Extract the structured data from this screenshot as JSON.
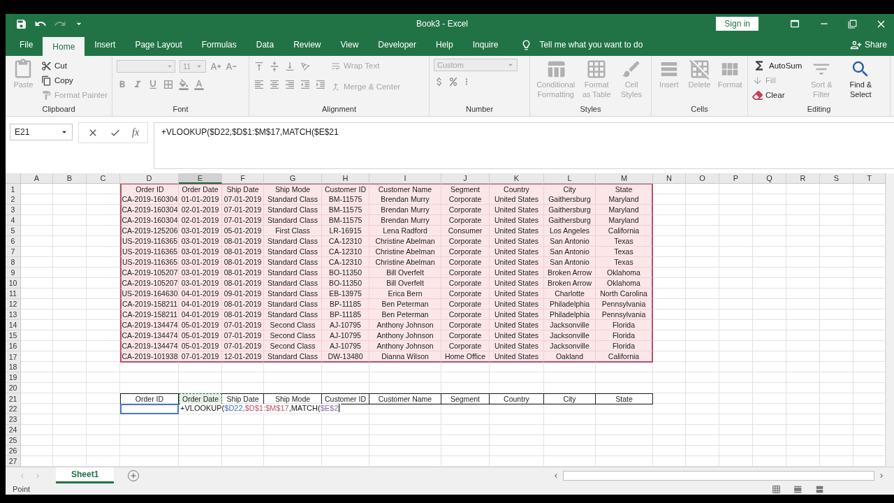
{
  "window": {
    "title": "Book3  -  Excel",
    "sign_in": "Sign in"
  },
  "tabs": [
    {
      "label": "File",
      "selected": false
    },
    {
      "label": "Home",
      "selected": true
    },
    {
      "label": "Insert",
      "selected": false
    },
    {
      "label": "Page Layout",
      "selected": false
    },
    {
      "label": "Formulas",
      "selected": false
    },
    {
      "label": "Data",
      "selected": false
    },
    {
      "label": "Review",
      "selected": false
    },
    {
      "label": "View",
      "selected": false
    },
    {
      "label": "Developer",
      "selected": false
    },
    {
      "label": "Help",
      "selected": false
    },
    {
      "label": "Inquire",
      "selected": false
    }
  ],
  "tell_me": "Tell me what you want to do",
  "share": "Share",
  "ribbon": [
    {
      "kind": "clipboard",
      "name": "Clipboard",
      "commands": [
        {
          "kind": "large",
          "label": "Paste",
          "disabled": true
        },
        {
          "kind": "small",
          "label": "Cut",
          "disabled": false
        },
        {
          "kind": "small",
          "label": "Copy",
          "disabled": false
        },
        {
          "kind": "small",
          "label": "Format Painter",
          "disabled": true
        }
      ]
    },
    {
      "kind": "font",
      "name": "Font",
      "commands": [
        {
          "kind": "combo",
          "label": "11",
          "disabled": true
        }
      ]
    },
    {
      "kind": "alignment",
      "name": "Alignment",
      "commands": [
        {
          "kind": "small",
          "label": "Wrap Text",
          "disabled": true
        },
        {
          "kind": "small",
          "label": "Merge & Center",
          "disabled": true
        }
      ]
    },
    {
      "kind": "number",
      "name": "Number",
      "commands": [
        {
          "kind": "combo",
          "label": "Custom",
          "disabled": true
        }
      ]
    },
    {
      "kind": "styles",
      "name": "Styles",
      "commands": [
        {
          "kind": "large",
          "label": "Conditional Formatting",
          "disabled": true
        },
        {
          "kind": "large",
          "label": "Format as Table",
          "disabled": true
        },
        {
          "kind": "large",
          "label": "Cell Styles",
          "disabled": true
        }
      ]
    },
    {
      "kind": "cells",
      "name": "Cells",
      "commands": [
        {
          "kind": "large",
          "label": "Insert",
          "disabled": true
        },
        {
          "kind": "large",
          "label": "Delete",
          "disabled": true
        },
        {
          "kind": "large",
          "label": "Format",
          "disabled": true
        }
      ]
    },
    {
      "kind": "editing",
      "name": "Editing",
      "commands": [
        {
          "kind": "small",
          "label": "AutoSum",
          "disabled": false
        },
        {
          "kind": "small",
          "label": "Fill",
          "disabled": true
        },
        {
          "kind": "small",
          "label": "Clear",
          "disabled": false
        },
        {
          "kind": "large",
          "label": "Sort & Filter",
          "disabled": true
        },
        {
          "kind": "large",
          "label": "Find & Select",
          "disabled": false
        }
      ]
    }
  ],
  "formula_bar": {
    "name_box": "E21",
    "function_button": "fx",
    "formula": "+VLOOKUP($D22,$D$1:$M$17,MATCH($E$21"
  },
  "columns": [
    {
      "label": "A",
      "selected": false
    },
    {
      "label": "B",
      "selected": false
    },
    {
      "label": "C",
      "selected": false
    },
    {
      "label": "D",
      "selected": false
    },
    {
      "label": "E",
      "selected": true
    },
    {
      "label": "F",
      "selected": false
    },
    {
      "label": "G",
      "selected": false
    },
    {
      "label": "H",
      "selected": false
    },
    {
      "label": "I",
      "selected": false
    },
    {
      "label": "J",
      "selected": false
    },
    {
      "label": "K",
      "selected": false
    },
    {
      "label": "L",
      "selected": false
    },
    {
      "label": "M",
      "selected": false
    },
    {
      "label": "N",
      "selected": false
    },
    {
      "label": "O",
      "selected": false
    },
    {
      "label": "P",
      "selected": false
    },
    {
      "label": "Q",
      "selected": false
    },
    {
      "label": "R",
      "selected": false
    },
    {
      "label": "S",
      "selected": false
    },
    {
      "label": "T",
      "selected": false
    }
  ],
  "rows": [
    {
      "number": "1",
      "kind": "source",
      "cells": [
        "Order ID",
        "Order Date",
        "Ship Date",
        "Ship Mode",
        "Customer ID",
        "Customer Name",
        "Segment",
        "Country",
        "City",
        "State"
      ]
    },
    {
      "number": "2",
      "kind": "source",
      "cells": [
        "CA-2019-160304",
        "01-01-2019",
        "07-01-2019",
        "Standard Class",
        "BM-11575",
        "Brendan Murry",
        "Corporate",
        "United States",
        "Gaithersburg",
        "Maryland"
      ]
    },
    {
      "number": "3",
      "kind": "source",
      "cells": [
        "CA-2019-160304",
        "02-01-2019",
        "07-01-2019",
        "Standard Class",
        "BM-11575",
        "Brendan Murry",
        "Corporate",
        "United States",
        "Gaithersburg",
        "Maryland"
      ]
    },
    {
      "number": "4",
      "kind": "source",
      "cells": [
        "CA-2019-160304",
        "02-01-2019",
        "07-01-2019",
        "Standard Class",
        "BM-11575",
        "Brendan Murry",
        "Corporate",
        "United States",
        "Gaithersburg",
        "Maryland"
      ]
    },
    {
      "number": "5",
      "kind": "source",
      "cells": [
        "CA-2019-125206",
        "03-01-2019",
        "05-01-2019",
        "First Class",
        "LR-16915",
        "Lena Radford",
        "Consumer",
        "United States",
        "Los Angeles",
        "California"
      ]
    },
    {
      "number": "6",
      "kind": "source",
      "cells": [
        "US-2019-116365",
        "03-01-2019",
        "08-01-2019",
        "Standard Class",
        "CA-12310",
        "Christine Abelman",
        "Corporate",
        "United States",
        "San Antonio",
        "Texas"
      ]
    },
    {
      "number": "7",
      "kind": "source",
      "cells": [
        "US-2019-116365",
        "03-01-2019",
        "08-01-2019",
        "Standard Class",
        "CA-12310",
        "Christine Abelman",
        "Corporate",
        "United States",
        "San Antonio",
        "Texas"
      ]
    },
    {
      "number": "8",
      "kind": "source",
      "cells": [
        "US-2019-116365",
        "03-01-2019",
        "08-01-2019",
        "Standard Class",
        "CA-12310",
        "Christine Abelman",
        "Corporate",
        "United States",
        "San Antonio",
        "Texas"
      ]
    },
    {
      "number": "9",
      "kind": "source",
      "cells": [
        "CA-2019-105207",
        "03-01-2019",
        "08-01-2019",
        "Standard Class",
        "BO-11350",
        "Bill Overfelt",
        "Corporate",
        "United States",
        "Broken Arrow",
        "Oklahoma"
      ]
    },
    {
      "number": "10",
      "kind": "source",
      "cells": [
        "CA-2019-105207",
        "03-01-2019",
        "08-01-2019",
        "Standard Class",
        "BO-11350",
        "Bill Overfelt",
        "Corporate",
        "United States",
        "Broken Arrow",
        "Oklahoma"
      ]
    },
    {
      "number": "11",
      "kind": "source",
      "cells": [
        "US-2019-164630",
        "04-01-2019",
        "09-01-2019",
        "Standard Class",
        "EB-13975",
        "Erica Bern",
        "Corporate",
        "United States",
        "Charlotte",
        "North Carolina"
      ]
    },
    {
      "number": "12",
      "kind": "source",
      "cells": [
        "CA-2019-158211",
        "04-01-2019",
        "08-01-2019",
        "Standard Class",
        "BP-11185",
        "Ben Peterman",
        "Corporate",
        "United States",
        "Philadelphia",
        "Pennsylvania"
      ]
    },
    {
      "number": "13",
      "kind": "source",
      "cells": [
        "CA-2019-158211",
        "04-01-2019",
        "08-01-2019",
        "Standard Class",
        "BP-11185",
        "Ben Peterman",
        "Corporate",
        "United States",
        "Philadelphia",
        "Pennsylvania"
      ]
    },
    {
      "number": "14",
      "kind": "source",
      "cells": [
        "CA-2019-134474",
        "05-01-2019",
        "07-01-2019",
        "Second Class",
        "AJ-10795",
        "Anthony Johnson",
        "Corporate",
        "United States",
        "Jacksonville",
        "Florida"
      ]
    },
    {
      "number": "15",
      "kind": "source",
      "cells": [
        "CA-2019-134474",
        "05-01-2019",
        "07-01-2019",
        "Second Class",
        "AJ-10795",
        "Anthony Johnson",
        "Corporate",
        "United States",
        "Jacksonville",
        "Florida"
      ]
    },
    {
      "number": "16",
      "kind": "source",
      "cells": [
        "CA-2019-134474",
        "05-01-2019",
        "07-01-2019",
        "Second Class",
        "AJ-10795",
        "Anthony Johnson",
        "Corporate",
        "United States",
        "Jacksonville",
        "Florida"
      ]
    },
    {
      "number": "17",
      "kind": "source",
      "cells": [
        "CA-2019-101938",
        "07-01-2019",
        "12-01-2019",
        "Standard Class",
        "DW-13480",
        "Dianna Wilson",
        "Home Office",
        "United States",
        "Oakland",
        "California"
      ]
    },
    {
      "number": "18",
      "kind": "empty"
    },
    {
      "number": "19",
      "kind": "empty"
    },
    {
      "number": "20",
      "kind": "empty"
    },
    {
      "number": "21",
      "kind": "header",
      "cells": [
        "Order ID",
        "Order Date",
        "Ship Date",
        "Ship Mode",
        "Customer ID",
        "Customer Name",
        "Segment",
        "Country",
        "City",
        "State"
      ]
    },
    {
      "number": "22",
      "kind": "edit",
      "segments": [
        {
          "text": "+VLOOKUP(",
          "color": "#202020"
        },
        {
          "text": "$D22,",
          "color": "#3b6cc0"
        },
        {
          "text": "$D$1:$M$17",
          "color": "#c0506a"
        },
        {
          "text": ",MATCH(",
          "color": "#202020"
        },
        {
          "text": "$E$2",
          "color": "#8a6ab0"
        }
      ]
    },
    {
      "number": "23",
      "kind": "empty"
    },
    {
      "number": "24",
      "kind": "empty"
    },
    {
      "number": "25",
      "kind": "empty"
    },
    {
      "number": "26",
      "kind": "empty"
    },
    {
      "number": "27",
      "kind": "empty"
    }
  ],
  "sheets": [
    {
      "label": "Sheet1",
      "selected": true
    }
  ],
  "status_bar": {
    "mode": "Point"
  }
}
